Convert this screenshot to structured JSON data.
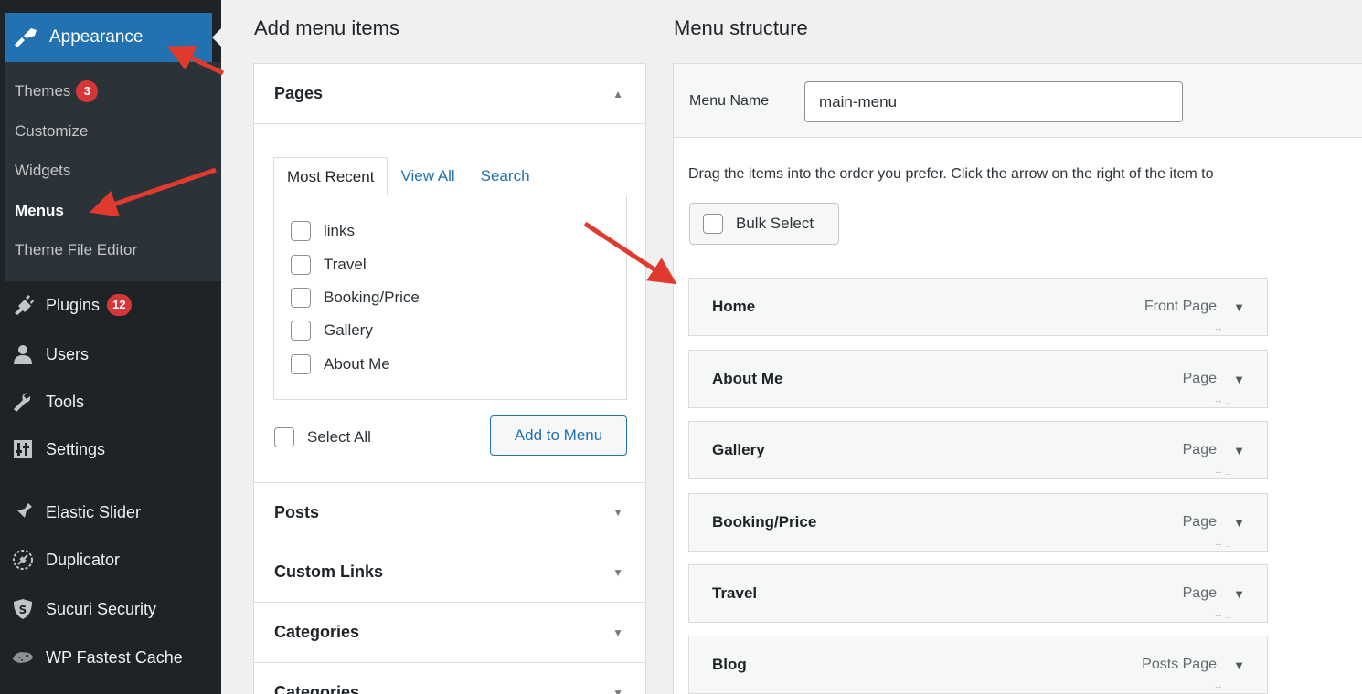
{
  "sidebar": {
    "active": {
      "label": "Appearance",
      "icon": "paintbrush-icon"
    },
    "submenu": [
      {
        "label": "Themes",
        "badge": "3"
      },
      {
        "label": "Customize"
      },
      {
        "label": "Widgets"
      },
      {
        "label": "Menus",
        "current": true
      },
      {
        "label": "Theme File Editor"
      }
    ],
    "items": [
      {
        "label": "Plugins",
        "badge": "12",
        "icon": "plugin-icon"
      },
      {
        "label": "Users",
        "icon": "users-icon"
      },
      {
        "label": "Tools",
        "icon": "wrench-icon"
      },
      {
        "label": "Settings",
        "icon": "settings-icon"
      },
      {
        "label": "Elastic Slider",
        "icon": "pin-icon"
      },
      {
        "label": "Duplicator",
        "icon": "duplicator-icon"
      },
      {
        "label": "Sucuri Security",
        "icon": "shield-icon"
      },
      {
        "label": "WP Fastest Cache",
        "icon": "cheetah-icon"
      }
    ]
  },
  "add_menu_items": {
    "heading": "Add menu items",
    "sections": [
      {
        "title": "Pages",
        "expanded": true
      },
      {
        "title": "Posts"
      },
      {
        "title": "Custom Links"
      },
      {
        "title": "Categories"
      },
      {
        "title": "Categories"
      }
    ],
    "tabs": [
      "Most Recent",
      "View All",
      "Search"
    ],
    "pages": [
      "links",
      "Travel",
      "Booking/Price",
      "Gallery",
      "About Me"
    ],
    "select_all": "Select All",
    "add_button": "Add to Menu"
  },
  "menu_structure": {
    "heading": "Menu structure",
    "menu_name_label": "Menu Name",
    "menu_name_value": "main-menu",
    "instructions": "Drag the items into the order you prefer. Click the arrow on the right of the item to",
    "bulk_select": "Bulk Select",
    "items": [
      {
        "title": "Home",
        "type": "Front Page"
      },
      {
        "title": "About Me",
        "type": "Page"
      },
      {
        "title": "Gallery",
        "type": "Page"
      },
      {
        "title": "Booking/Price",
        "type": "Page"
      },
      {
        "title": "Travel",
        "type": "Page"
      },
      {
        "title": "Blog",
        "type": "Posts Page"
      }
    ]
  },
  "colors": {
    "sidebar_bg": "#1d2327",
    "sidebar_active": "#2271b1",
    "badge": "#d63638",
    "arrow": "#e03a2f"
  }
}
